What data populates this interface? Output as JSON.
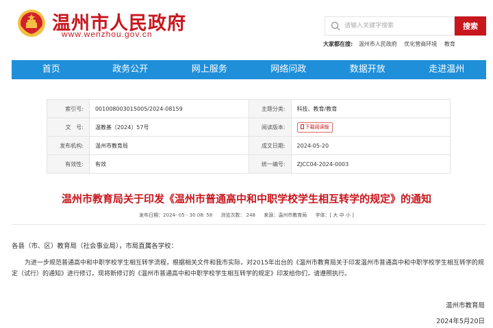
{
  "header": {
    "site_title": "温州市人民政府",
    "site_url": "www.wenzhou.gov.cn",
    "search_placeholder": "请输入关键字搜索",
    "search_button": "搜索",
    "hot_search_label": "大家都在搜:",
    "hot_search_links": [
      "温州市人民政府",
      "优化营商环境",
      "教育"
    ]
  },
  "nav": {
    "items": [
      "首页",
      "政务公开",
      "网上服务",
      "网络问政",
      "数据开放",
      "走进温州"
    ]
  },
  "info": {
    "index_label": "索引号:",
    "index_value": "001008003015005/2024-08159",
    "category_label": "主题分类:",
    "category_value": "科技、教育/教育",
    "docno_label": "文   号:",
    "docno_value": "温教基〔2024〕57号",
    "reader_label": "阅读版本:",
    "reader_value": "下载阅读版",
    "issuer_label": "发布机构:",
    "issuer_value": "温州市教育局",
    "created_label": "成文日期:",
    "created_value": "2024-05-20",
    "validity_label": "有效性:",
    "validity_value": "有效",
    "unified_label": "统一编号:",
    "unified_value": "ZJCC04-2024-0003"
  },
  "article": {
    "title": "温州市教育局关于印发《温州市普通高中和中职学校学生相互转学的规定》的通知",
    "publish_date": "发布日期：2024- 05 - 30 08: 58",
    "views": "浏览次数：  248",
    "source": "来源：温州市教育局",
    "font_size": "字体：[ 大  中  小 ]",
    "salutation": "各县（市、区）教育局（社会事业局），市局直属各学校：",
    "body": "为进一步规范普通高中和中职学校学生相互转学流程，根据相关文件和我市实际，对2015年出台的《温州市教育局关于印发温州市普通高中和中职学校学生相互转学的规定（试行）的通知》进行修订。现将新修订的《温州市普通高中和中职学校学生相互转学的规定》印发给你们，请遵照执行。",
    "sign_org": "温州市教育局",
    "sign_date": "2024年5月20日"
  },
  "colors": {
    "brand_red": "#c8161d",
    "nav_blue": "#1f8fda"
  },
  "icons": {
    "emblem": "national-emblem-icon",
    "search": "search-icon",
    "download": "document-icon"
  }
}
